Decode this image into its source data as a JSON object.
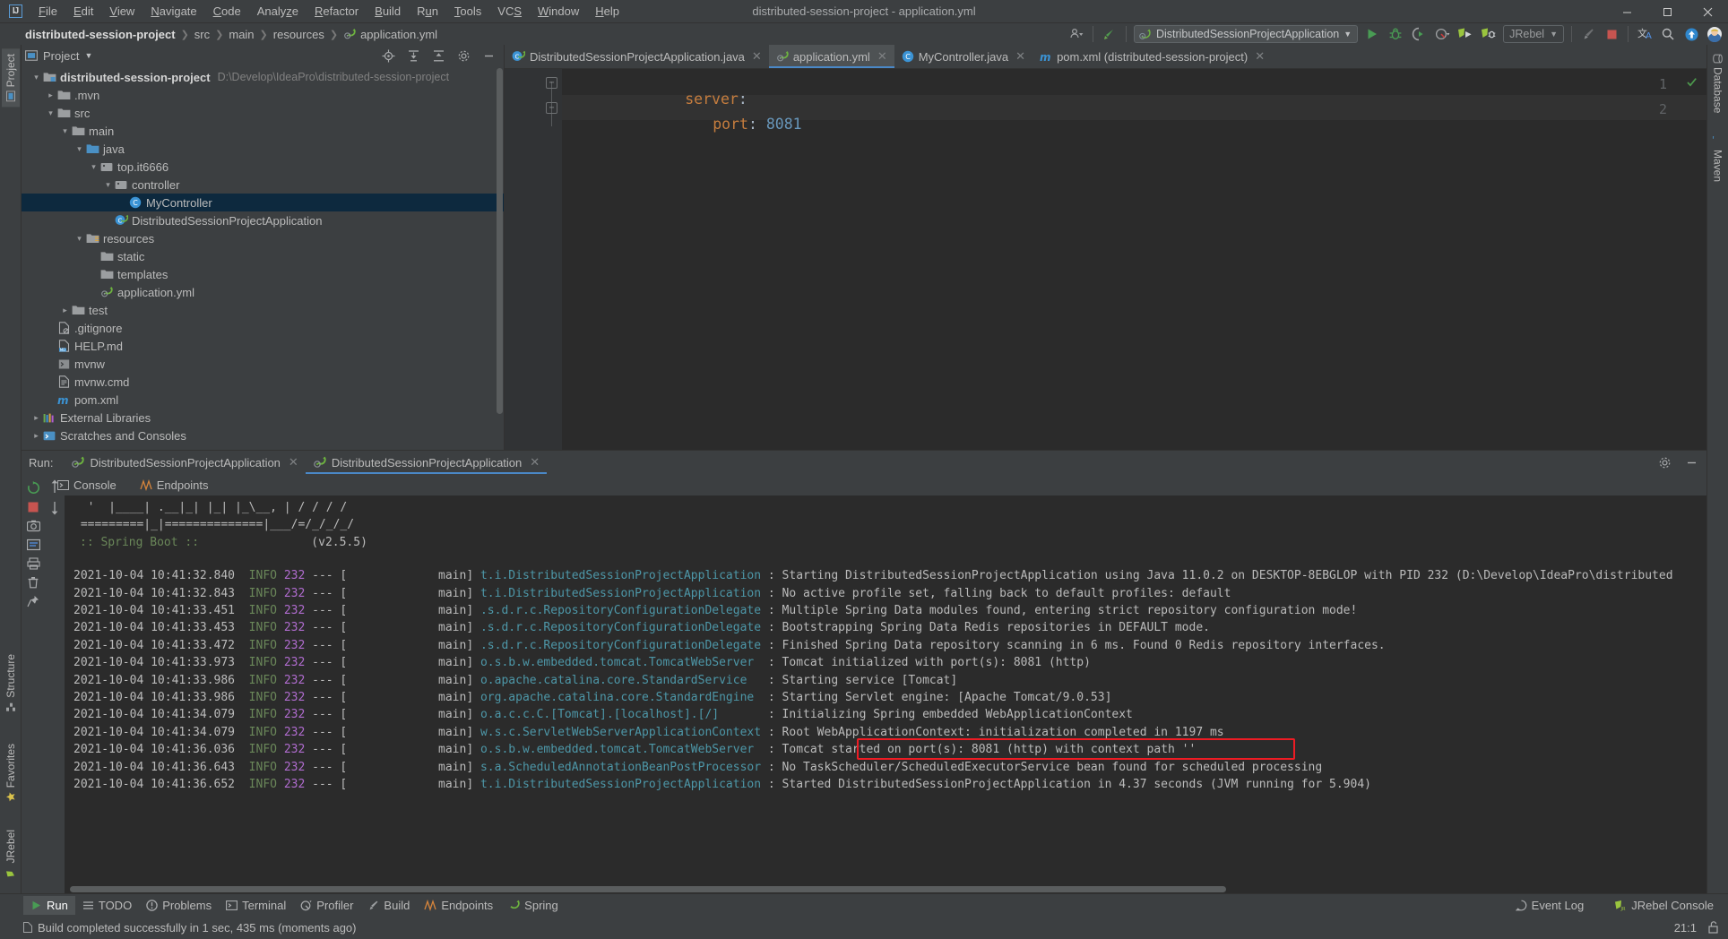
{
  "window": {
    "title": "distributed-session-project - application.yml",
    "app_icon": "intellij-idea-logo",
    "controls": {
      "minimize": "—",
      "maximize": "☐",
      "close": "✕"
    }
  },
  "menubar": {
    "items": [
      {
        "label": "File",
        "mnemonic": "F"
      },
      {
        "label": "Edit",
        "mnemonic": "E"
      },
      {
        "label": "View",
        "mnemonic": "V"
      },
      {
        "label": "Navigate",
        "mnemonic": "N"
      },
      {
        "label": "Code",
        "mnemonic": "C"
      },
      {
        "label": "Analyze",
        "mnemonic": "z"
      },
      {
        "label": "Refactor",
        "mnemonic": "R"
      },
      {
        "label": "Build",
        "mnemonic": "B"
      },
      {
        "label": "Run",
        "mnemonic": "u"
      },
      {
        "label": "Tools",
        "mnemonic": "T"
      },
      {
        "label": "VCS",
        "mnemonic": "S"
      },
      {
        "label": "Window",
        "mnemonic": "W"
      },
      {
        "label": "Help",
        "mnemonic": "H"
      }
    ]
  },
  "navbar": {
    "breadcrumbs": [
      "distributed-session-project",
      "src",
      "main",
      "resources",
      "application.yml"
    ],
    "separator": "❯",
    "run_config": "DistributedSessionProjectApplication",
    "jrebel_label": "JRebel",
    "icons": [
      "settings-sync-icon",
      "search-everywhere-icon",
      "update-project-icon",
      "run-icon",
      "debug-icon",
      "run-coverage-icon",
      "profiler-icon",
      "jrebel-run-icon",
      "jrebel-debug-icon",
      "build-icon",
      "stop-icon",
      "translate-icon",
      "search-icon",
      "upload-icon",
      "avatar-icon"
    ]
  },
  "left_strip": {
    "tabs": [
      {
        "label": "Project",
        "icon": "project-icon",
        "active": true
      },
      {
        "label": "Structure",
        "icon": "structure-icon",
        "active": false
      },
      {
        "label": "Favorites",
        "icon": "favorites-icon",
        "active": false
      },
      {
        "label": "JRebel",
        "icon": "jrebel-icon",
        "active": false
      }
    ]
  },
  "right_strip": {
    "tabs": [
      {
        "label": "Database",
        "icon": "database-icon"
      },
      {
        "label": "Maven",
        "icon": "maven-icon"
      }
    ]
  },
  "project_panel": {
    "title": "Project",
    "chevron": "▾",
    "actions": [
      "locate-icon",
      "expand-all-icon",
      "collapse-all-icon",
      "settings-icon",
      "hide-icon"
    ],
    "tree": [
      {
        "indent": 0,
        "arrow": "▾",
        "icon": "project-root-icon",
        "label": "distributed-session-project",
        "bold": true,
        "path": "D:\\Develop\\IdeaPro\\distributed-session-project",
        "selected": false
      },
      {
        "indent": 1,
        "arrow": "▸",
        "icon": "folder-icon",
        "label": ".mvn",
        "bold": false,
        "path": "",
        "selected": false
      },
      {
        "indent": 1,
        "arrow": "▾",
        "icon": "folder-icon",
        "label": "src",
        "bold": false,
        "path": "",
        "selected": false
      },
      {
        "indent": 2,
        "arrow": "▾",
        "icon": "folder-icon",
        "label": "main",
        "bold": false,
        "path": "",
        "selected": false
      },
      {
        "indent": 3,
        "arrow": "▾",
        "icon": "source-folder-icon",
        "label": "java",
        "bold": false,
        "path": "",
        "selected": false
      },
      {
        "indent": 4,
        "arrow": "▾",
        "icon": "package-icon",
        "label": "top.it6666",
        "bold": false,
        "path": "",
        "selected": false
      },
      {
        "indent": 5,
        "arrow": "▾",
        "icon": "package-icon",
        "label": "controller",
        "bold": false,
        "path": "",
        "selected": false
      },
      {
        "indent": 6,
        "arrow": "",
        "icon": "java-class-icon",
        "label": "MyController",
        "bold": false,
        "path": "",
        "selected": true
      },
      {
        "indent": 5,
        "arrow": "",
        "icon": "spring-class-icon",
        "label": "DistributedSessionProjectApplication",
        "bold": false,
        "path": "",
        "selected": false
      },
      {
        "indent": 3,
        "arrow": "▾",
        "icon": "resources-folder-icon",
        "label": "resources",
        "bold": false,
        "path": "",
        "selected": false
      },
      {
        "indent": 4,
        "arrow": "",
        "icon": "folder-icon",
        "label": "static",
        "bold": false,
        "path": "",
        "selected": false
      },
      {
        "indent": 4,
        "arrow": "",
        "icon": "folder-icon",
        "label": "templates",
        "bold": false,
        "path": "",
        "selected": false
      },
      {
        "indent": 4,
        "arrow": "",
        "icon": "spring-yaml-icon",
        "label": "application.yml",
        "bold": false,
        "path": "",
        "selected": false
      },
      {
        "indent": 2,
        "arrow": "▸",
        "icon": "folder-icon",
        "label": "test",
        "bold": false,
        "path": "",
        "selected": false
      },
      {
        "indent": 1,
        "arrow": "",
        "icon": "gitignore-icon",
        "label": ".gitignore",
        "bold": false,
        "path": "",
        "selected": false
      },
      {
        "indent": 1,
        "arrow": "",
        "icon": "markdown-icon",
        "label": "HELP.md",
        "bold": false,
        "path": "",
        "selected": false
      },
      {
        "indent": 1,
        "arrow": "",
        "icon": "script-icon",
        "label": "mvnw",
        "bold": false,
        "path": "",
        "selected": false
      },
      {
        "indent": 1,
        "arrow": "",
        "icon": "cmd-icon",
        "label": "mvnw.cmd",
        "bold": false,
        "path": "",
        "selected": false
      },
      {
        "indent": 1,
        "arrow": "",
        "icon": "maven-pom-icon",
        "label": "pom.xml",
        "bold": false,
        "path": "",
        "selected": false
      },
      {
        "indent": 0,
        "arrow": "▸",
        "icon": "external-libraries-icon",
        "label": "External Libraries",
        "bold": false,
        "path": "",
        "selected": false
      },
      {
        "indent": 0,
        "arrow": "▸",
        "icon": "scratches-icon",
        "label": "Scratches and Consoles",
        "bold": false,
        "path": "",
        "selected": false
      }
    ]
  },
  "editor": {
    "tabs": [
      {
        "label": "DistributedSessionProjectApplication.java",
        "icon": "spring-class-icon",
        "active": false
      },
      {
        "label": "application.yml",
        "icon": "spring-yaml-icon",
        "active": true
      },
      {
        "label": "MyController.java",
        "icon": "java-class-icon",
        "active": false
      },
      {
        "label": "pom.xml (distributed-session-project)",
        "icon": "maven-pom-icon",
        "active": false
      }
    ],
    "close_glyph": "✕",
    "lines": [
      {
        "no": "1",
        "indent": 0,
        "key": "server",
        "colon": ":",
        "value": ""
      },
      {
        "no": "2",
        "indent": 1,
        "key": "port",
        "colon": ":",
        "value": "8081"
      }
    ],
    "fold_glyph": "−",
    "inspection_status": "ok-check"
  },
  "run_panel": {
    "label": "Run:",
    "tabs": [
      {
        "label": "DistributedSessionProjectApplication",
        "icon": "spring-run-icon",
        "active": false
      },
      {
        "label": "DistributedSessionProjectApplication",
        "icon": "spring-run-icon",
        "active": true
      }
    ],
    "close_glyph": "✕",
    "header_actions": [
      "settings-icon",
      "hide-icon"
    ],
    "side_tabs": [
      {
        "label": "Console",
        "icon": "console-icon"
      },
      {
        "label": "Endpoints",
        "icon": "endpoints-icon"
      }
    ],
    "toolbar_icons": [
      "rerun-icon",
      "stop-icon",
      "screenshot-icon",
      "thread-dump-icon",
      "restart-icon",
      "print-icon",
      "delete-icon",
      "pin-icon",
      "scroll-up-icon",
      "scroll-down-icon"
    ],
    "console": {
      "banner": [
        "  '  |____| .__|_| |_| |_\\__, | / / / /",
        " =========|_|==============|___/=/_/_/_/",
        " :: Spring Boot ::                (v2.5.5)"
      ],
      "banner_version_label": ":: Spring Boot ::",
      "banner_version": "(v2.5.5)",
      "logs": [
        {
          "ts": "2021-10-04 10:41:32.840",
          "level": "INFO",
          "pid": "232",
          "sep": "--- [",
          "thread": "main]",
          "logger": "t.i.DistributedSessionProjectApplication",
          "colon": ":",
          "msg": "Starting DistributedSessionProjectApplication using Java 11.0.2 on DESKTOP-8EBGLOP with PID 232 (D:\\Develop\\IdeaPro\\distributed",
          "highlight": false
        },
        {
          "ts": "2021-10-04 10:41:32.843",
          "level": "INFO",
          "pid": "232",
          "sep": "--- [",
          "thread": "main]",
          "logger": "t.i.DistributedSessionProjectApplication",
          "colon": ":",
          "msg": "No active profile set, falling back to default profiles: default",
          "highlight": false
        },
        {
          "ts": "2021-10-04 10:41:33.451",
          "level": "INFO",
          "pid": "232",
          "sep": "--- [",
          "thread": "main]",
          "logger": ".s.d.r.c.RepositoryConfigurationDelegate",
          "colon": ":",
          "msg": "Multiple Spring Data modules found, entering strict repository configuration mode!",
          "highlight": false
        },
        {
          "ts": "2021-10-04 10:41:33.453",
          "level": "INFO",
          "pid": "232",
          "sep": "--- [",
          "thread": "main]",
          "logger": ".s.d.r.c.RepositoryConfigurationDelegate",
          "colon": ":",
          "msg": "Bootstrapping Spring Data Redis repositories in DEFAULT mode.",
          "highlight": false
        },
        {
          "ts": "2021-10-04 10:41:33.472",
          "level": "INFO",
          "pid": "232",
          "sep": "--- [",
          "thread": "main]",
          "logger": ".s.d.r.c.RepositoryConfigurationDelegate",
          "colon": ":",
          "msg": "Finished Spring Data repository scanning in 6 ms. Found 0 Redis repository interfaces.",
          "highlight": false
        },
        {
          "ts": "2021-10-04 10:41:33.973",
          "level": "INFO",
          "pid": "232",
          "sep": "--- [",
          "thread": "main]",
          "logger": "o.s.b.w.embedded.tomcat.TomcatWebServer",
          "colon": ":",
          "msg": "Tomcat initialized with port(s): 8081 (http)",
          "highlight": false
        },
        {
          "ts": "2021-10-04 10:41:33.986",
          "level": "INFO",
          "pid": "232",
          "sep": "--- [",
          "thread": "main]",
          "logger": "o.apache.catalina.core.StandardService",
          "colon": ":",
          "msg": "Starting service [Tomcat]",
          "highlight": false
        },
        {
          "ts": "2021-10-04 10:41:33.986",
          "level": "INFO",
          "pid": "232",
          "sep": "--- [",
          "thread": "main]",
          "logger": "org.apache.catalina.core.StandardEngine",
          "colon": ":",
          "msg": "Starting Servlet engine: [Apache Tomcat/9.0.53]",
          "highlight": false
        },
        {
          "ts": "2021-10-04 10:41:34.079",
          "level": "INFO",
          "pid": "232",
          "sep": "--- [",
          "thread": "main]",
          "logger": "o.a.c.c.C.[Tomcat].[localhost].[/]",
          "colon": ":",
          "msg": "Initializing Spring embedded WebApplicationContext",
          "highlight": false
        },
        {
          "ts": "2021-10-04 10:41:34.079",
          "level": "INFO",
          "pid": "232",
          "sep": "--- [",
          "thread": "main]",
          "logger": "w.s.c.ServletWebServerApplicationContext",
          "colon": ":",
          "msg": "Root WebApplicationContext: initialization completed in 1197 ms",
          "highlight": false
        },
        {
          "ts": "2021-10-04 10:41:36.036",
          "level": "INFO",
          "pid": "232",
          "sep": "--- [",
          "thread": "main]",
          "logger": "o.s.b.w.embedded.tomcat.TomcatWebServer",
          "colon": ":",
          "msg": "Tomcat started on port(s): 8081 (http) with context path ''",
          "highlight": true
        },
        {
          "ts": "2021-10-04 10:41:36.643",
          "level": "INFO",
          "pid": "232",
          "sep": "--- [",
          "thread": "main]",
          "logger": "s.a.ScheduledAnnotationBeanPostProcessor",
          "colon": ":",
          "msg": "No TaskScheduler/ScheduledExecutorService bean found for scheduled processing",
          "highlight": false
        },
        {
          "ts": "2021-10-04 10:41:36.652",
          "level": "INFO",
          "pid": "232",
          "sep": "--- [",
          "thread": "main]",
          "logger": "t.i.DistributedSessionProjectApplication",
          "colon": ":",
          "msg": "Started DistributedSessionProjectApplication in 4.37 seconds (JVM running for 5.904)",
          "highlight": false
        }
      ]
    }
  },
  "bottom_bar": {
    "tabs": [
      {
        "label": "Run",
        "icon": "run-icon",
        "active": true
      },
      {
        "label": "TODO",
        "icon": "todo-icon",
        "active": false
      },
      {
        "label": "Problems",
        "icon": "problems-icon",
        "active": false
      },
      {
        "label": "Terminal",
        "icon": "terminal-icon",
        "active": false
      },
      {
        "label": "Profiler",
        "icon": "profiler-icon",
        "active": false
      },
      {
        "label": "Build",
        "icon": "build-icon",
        "active": false
      },
      {
        "label": "Endpoints",
        "icon": "endpoints-icon",
        "active": false
      },
      {
        "label": "Spring",
        "icon": "spring-icon",
        "active": false
      }
    ],
    "right_tabs": [
      {
        "label": "Event Log",
        "icon": "event-log-icon"
      },
      {
        "label": "JRebel Console",
        "icon": "jrebel-icon"
      }
    ]
  },
  "statusbar": {
    "message": "Build completed successfully in 1 sec, 435 ms (moments ago)",
    "caret_position": "21:1",
    "lock_icon": "unlocked-icon"
  },
  "colors": {
    "accent_blue": "#4a88c7",
    "selection_blue": "#0d293e",
    "editor_bg": "#2b2b2b",
    "panel_bg": "#3c3f41",
    "error_red": "#ed1c24",
    "spring_green": "#6a8759",
    "log_magenta": "#b06ccf",
    "log_cyan": "#4d97a8",
    "yaml_key_orange": "#c67d3e",
    "yaml_number_blue": "#6897bb"
  }
}
